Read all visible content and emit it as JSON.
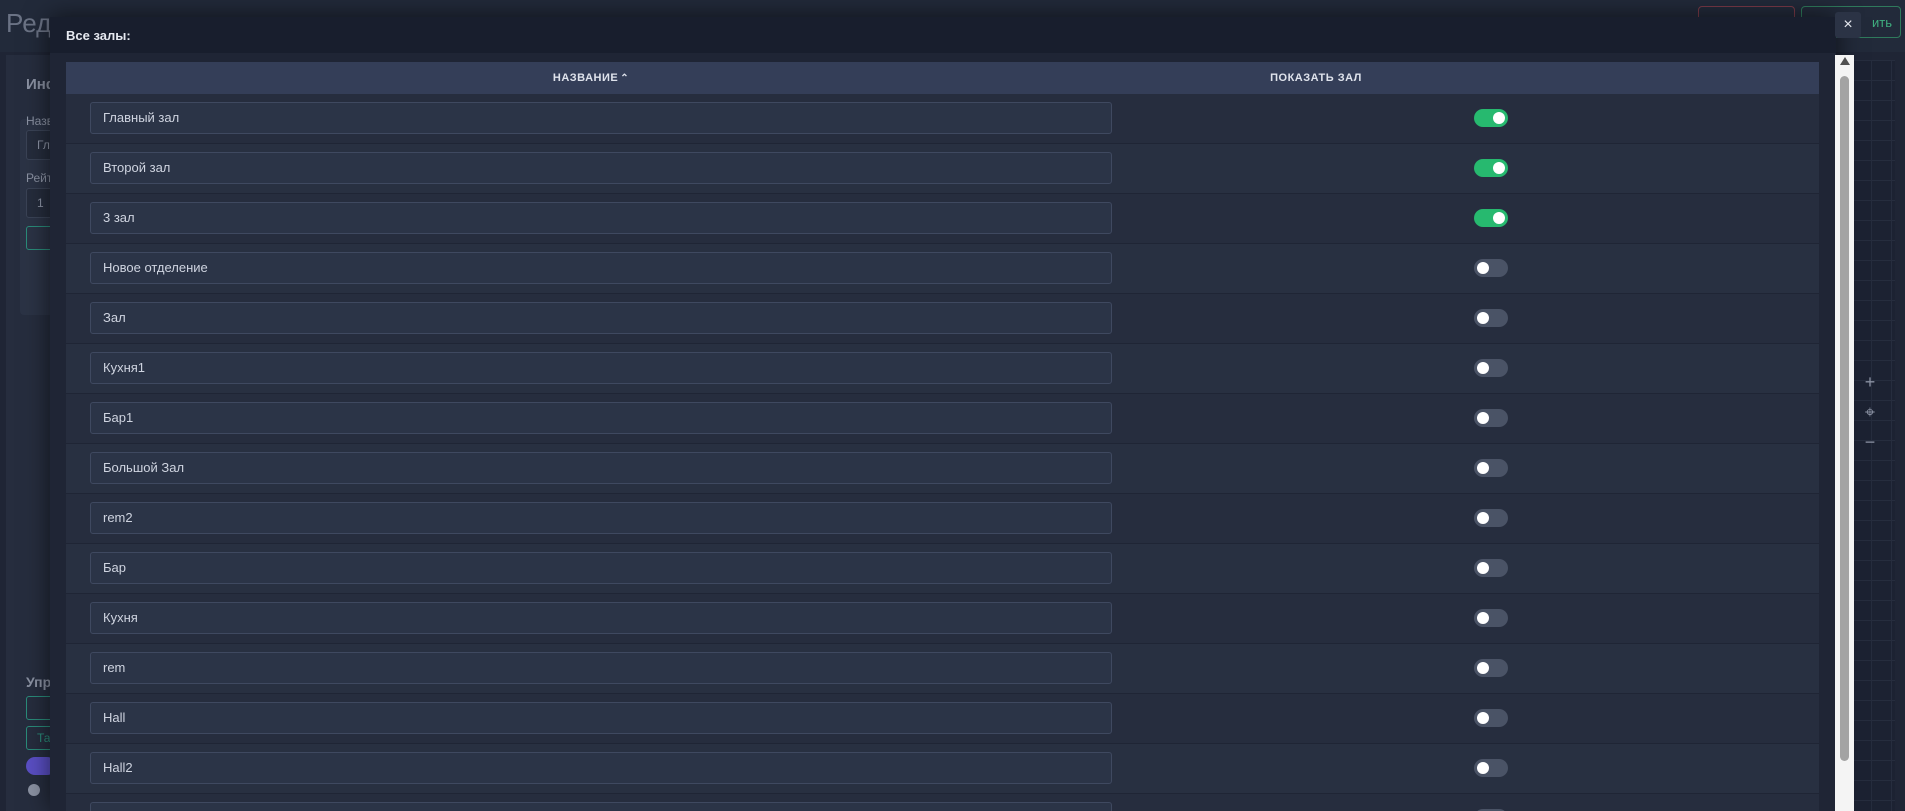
{
  "background": {
    "title": "Ред",
    "save_label": "ить",
    "sidebar_labels": [
      "Инф",
      "Назв",
      "Гл",
      "Рейт",
      "1",
      "Упра",
      "Та"
    ]
  },
  "modal": {
    "title": "Все залы:",
    "close_symbol": "×",
    "columns": {
      "name": "НАЗВАНИЕ",
      "sort_symbol": "⌃",
      "show": "ПОКАЗАТЬ ЗАЛ"
    },
    "rows": [
      {
        "name": "Главный зал",
        "show": true
      },
      {
        "name": "Второй зал",
        "show": true
      },
      {
        "name": "3 зал",
        "show": true
      },
      {
        "name": "Новое отделение",
        "show": false
      },
      {
        "name": "Зал",
        "show": false
      },
      {
        "name": "Кухня1",
        "show": false
      },
      {
        "name": "Бар1",
        "show": false
      },
      {
        "name": "Большой Зал",
        "show": false
      },
      {
        "name": "rem2",
        "show": false
      },
      {
        "name": "Бар",
        "show": false
      },
      {
        "name": "Кухня",
        "show": false
      },
      {
        "name": "rem",
        "show": false
      },
      {
        "name": "Hall",
        "show": false
      },
      {
        "name": "Hall2",
        "show": false
      },
      {
        "name": "",
        "show": false
      }
    ]
  },
  "zoom_controls": {
    "plus": "+",
    "center": "⌖",
    "minus": "−"
  },
  "colors": {
    "toggle_on": "#27b96f",
    "toggle_off": "#4a5366",
    "accent_purple": "#5a4fc4"
  }
}
